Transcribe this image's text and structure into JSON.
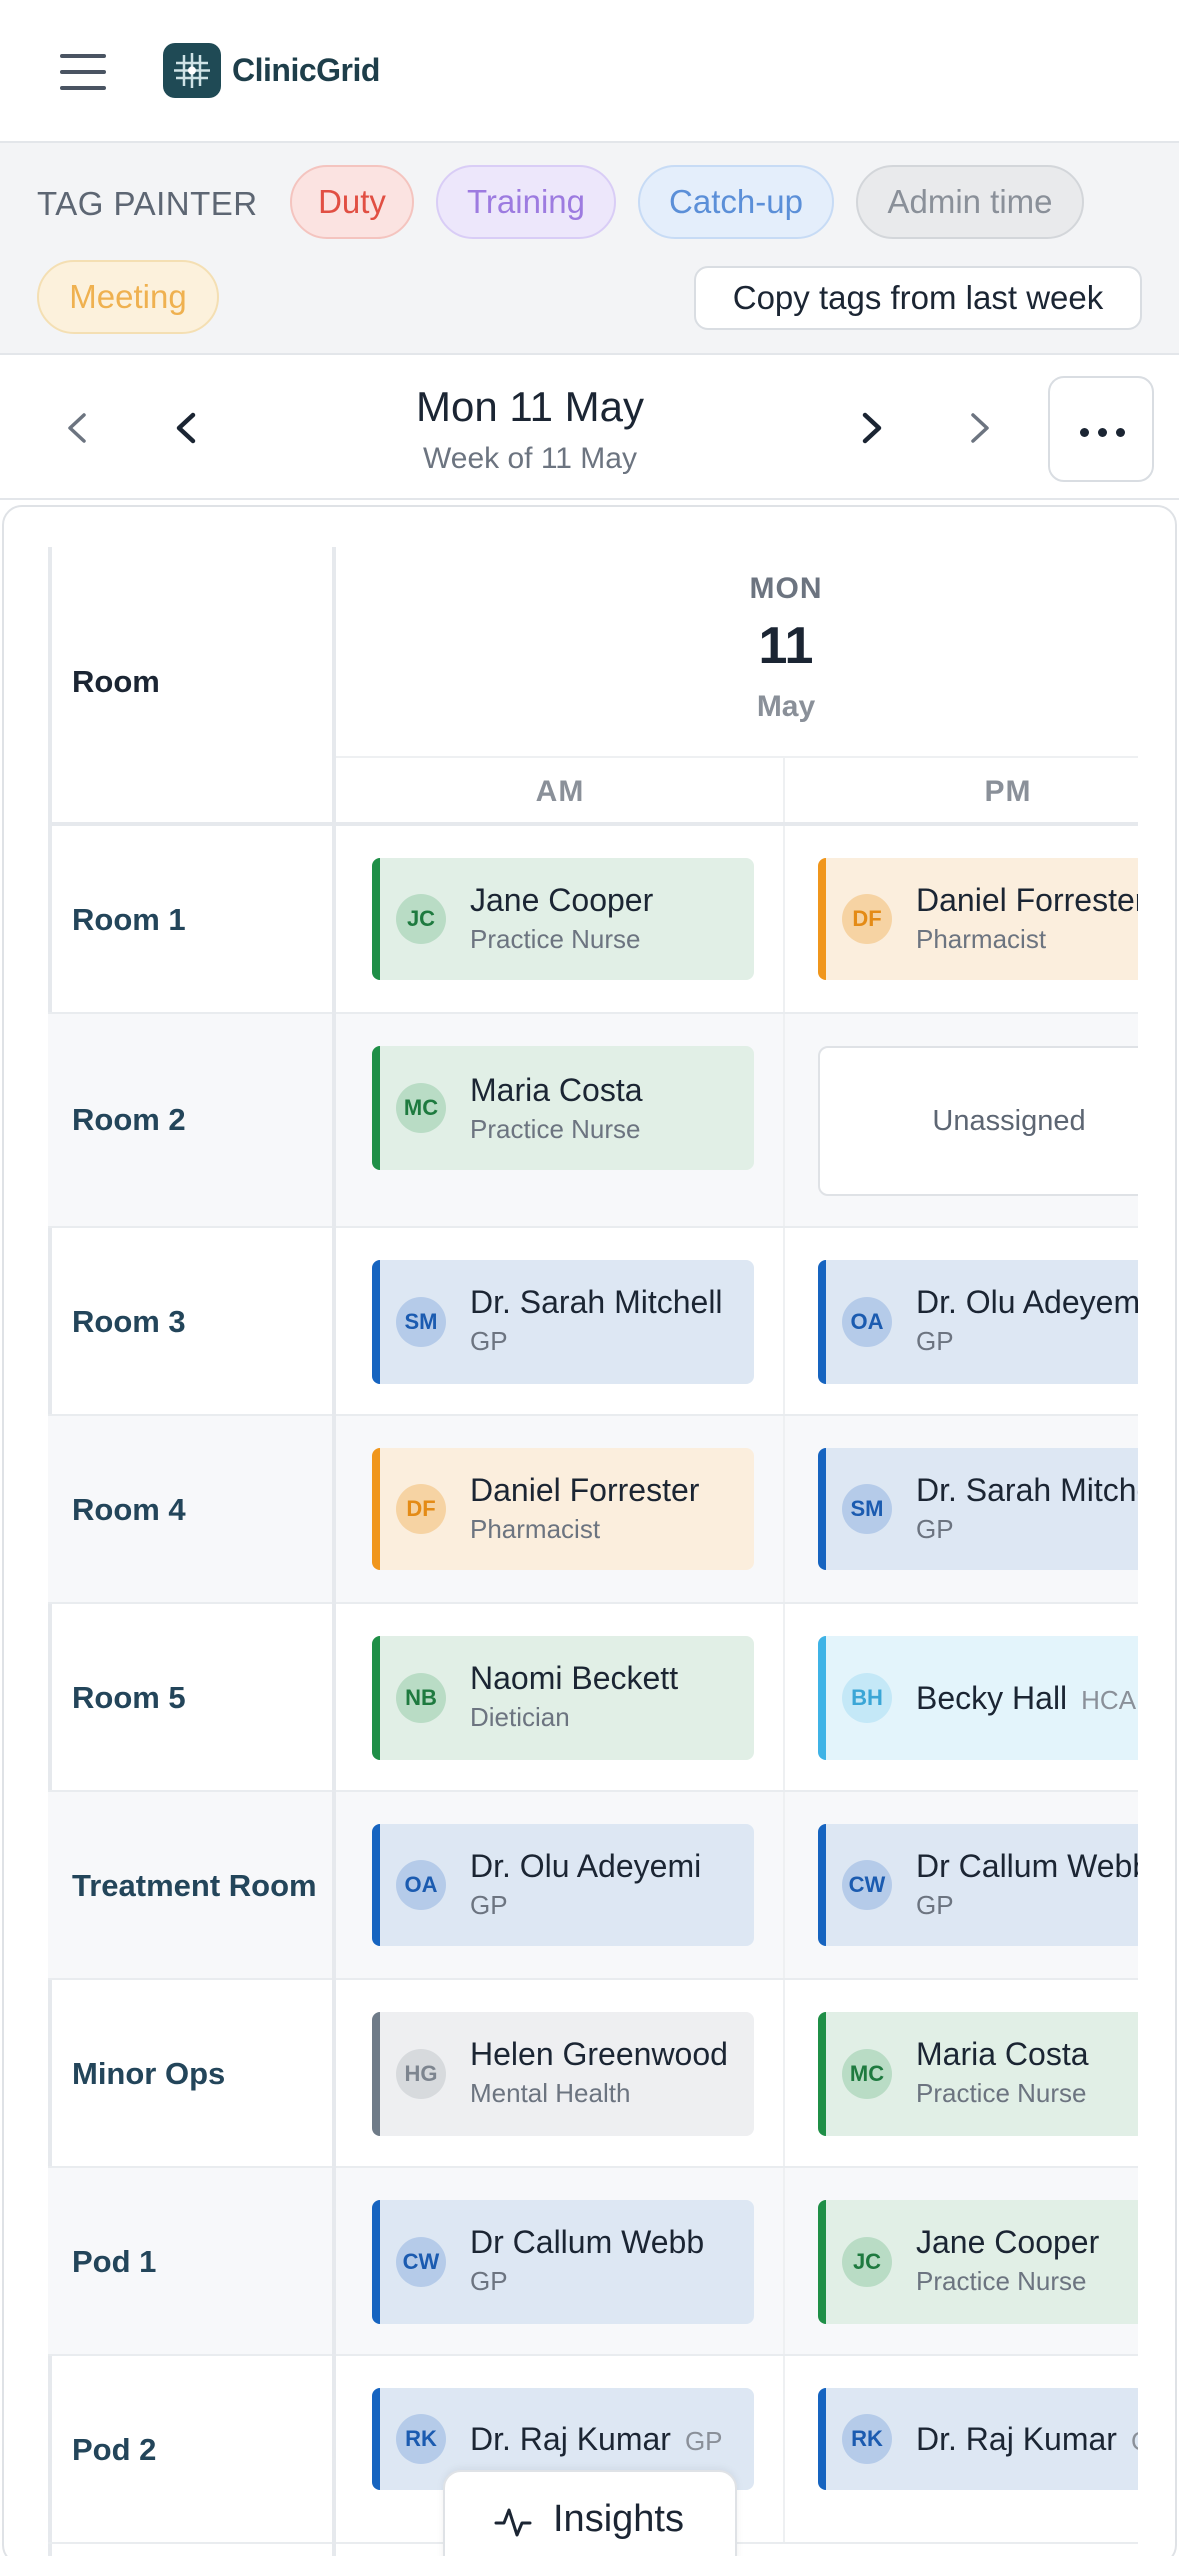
{
  "header": {
    "app_name": "ClinicGrid",
    "menu_icon": "hamburger-icon",
    "logo_icon": "grid-logo-icon"
  },
  "tag_painter": {
    "label": "TAG PAINTER",
    "tags": [
      "Duty",
      "Training",
      "Catch-up",
      "Admin time",
      "Meeting"
    ],
    "copy_button": "Copy tags from last week"
  },
  "date_nav": {
    "title": "Mon 11 May",
    "subtitle": "Week of 11 May"
  },
  "grid": {
    "room_header": "Room",
    "day": {
      "dow": "MON",
      "date": "11",
      "month": "May"
    },
    "am": "AM",
    "pm": "PM",
    "rows": [
      {
        "room": "Room 1",
        "am": {
          "initials": "JC",
          "name": "Jane Cooper",
          "role": "Practice Nurse"
        },
        "pm": {
          "initials": "DF",
          "name": "Daniel Forrester",
          "role": "Pharmacist"
        }
      },
      {
        "room": "Room 2",
        "am": {
          "initials": "MC",
          "name": "Maria Costa",
          "role": "Practice Nurse"
        },
        "pm": {
          "unassigned": "Unassigned"
        }
      },
      {
        "room": "Room 3",
        "am": {
          "initials": "SM",
          "name": "Dr. Sarah Mitchell",
          "role": "GP"
        },
        "pm": {
          "initials": "OA",
          "name": "Dr. Olu Adeyemi",
          "role": "GP"
        }
      },
      {
        "room": "Room 4",
        "am": {
          "initials": "DF",
          "name": "Daniel Forrester",
          "role": "Pharmacist"
        },
        "pm": {
          "initials": "SM",
          "name": "Dr. Sarah Mitchell",
          "role": "GP"
        }
      },
      {
        "room": "Room 5",
        "am": {
          "initials": "NB",
          "name": "Naomi Beckett",
          "role": "Dietician"
        },
        "pm": {
          "initials": "BH",
          "name": "Becky Hall",
          "role": "HCA"
        }
      },
      {
        "room": "Treatment Room",
        "am": {
          "initials": "OA",
          "name": "Dr. Olu Adeyemi",
          "role": "GP"
        },
        "pm": {
          "initials": "CW",
          "name": "Dr Callum Webb",
          "role": "GP"
        }
      },
      {
        "room": "Minor Ops",
        "am": {
          "initials": "HG",
          "name": "Helen Greenwood",
          "role": "Mental Health"
        },
        "pm": {
          "initials": "MC",
          "name": "Maria Costa",
          "role": "Practice Nurse"
        }
      },
      {
        "room": "Pod 1",
        "am": {
          "initials": "CW",
          "name": "Dr Callum Webb",
          "role": "GP"
        },
        "pm": {
          "initials": "JC",
          "name": "Jane Cooper",
          "role": "Practice Nurse"
        }
      },
      {
        "room": "Pod 2",
        "am": {
          "initials": "RK",
          "name": "Dr. Raj Kumar",
          "role": "GP"
        },
        "pm": {
          "initials": "RK",
          "name": "Dr. Raj Kumar",
          "role": "GP"
        }
      }
    ]
  },
  "insights": {
    "label": "Insights",
    "icon": "activity-pulse-icon"
  }
}
